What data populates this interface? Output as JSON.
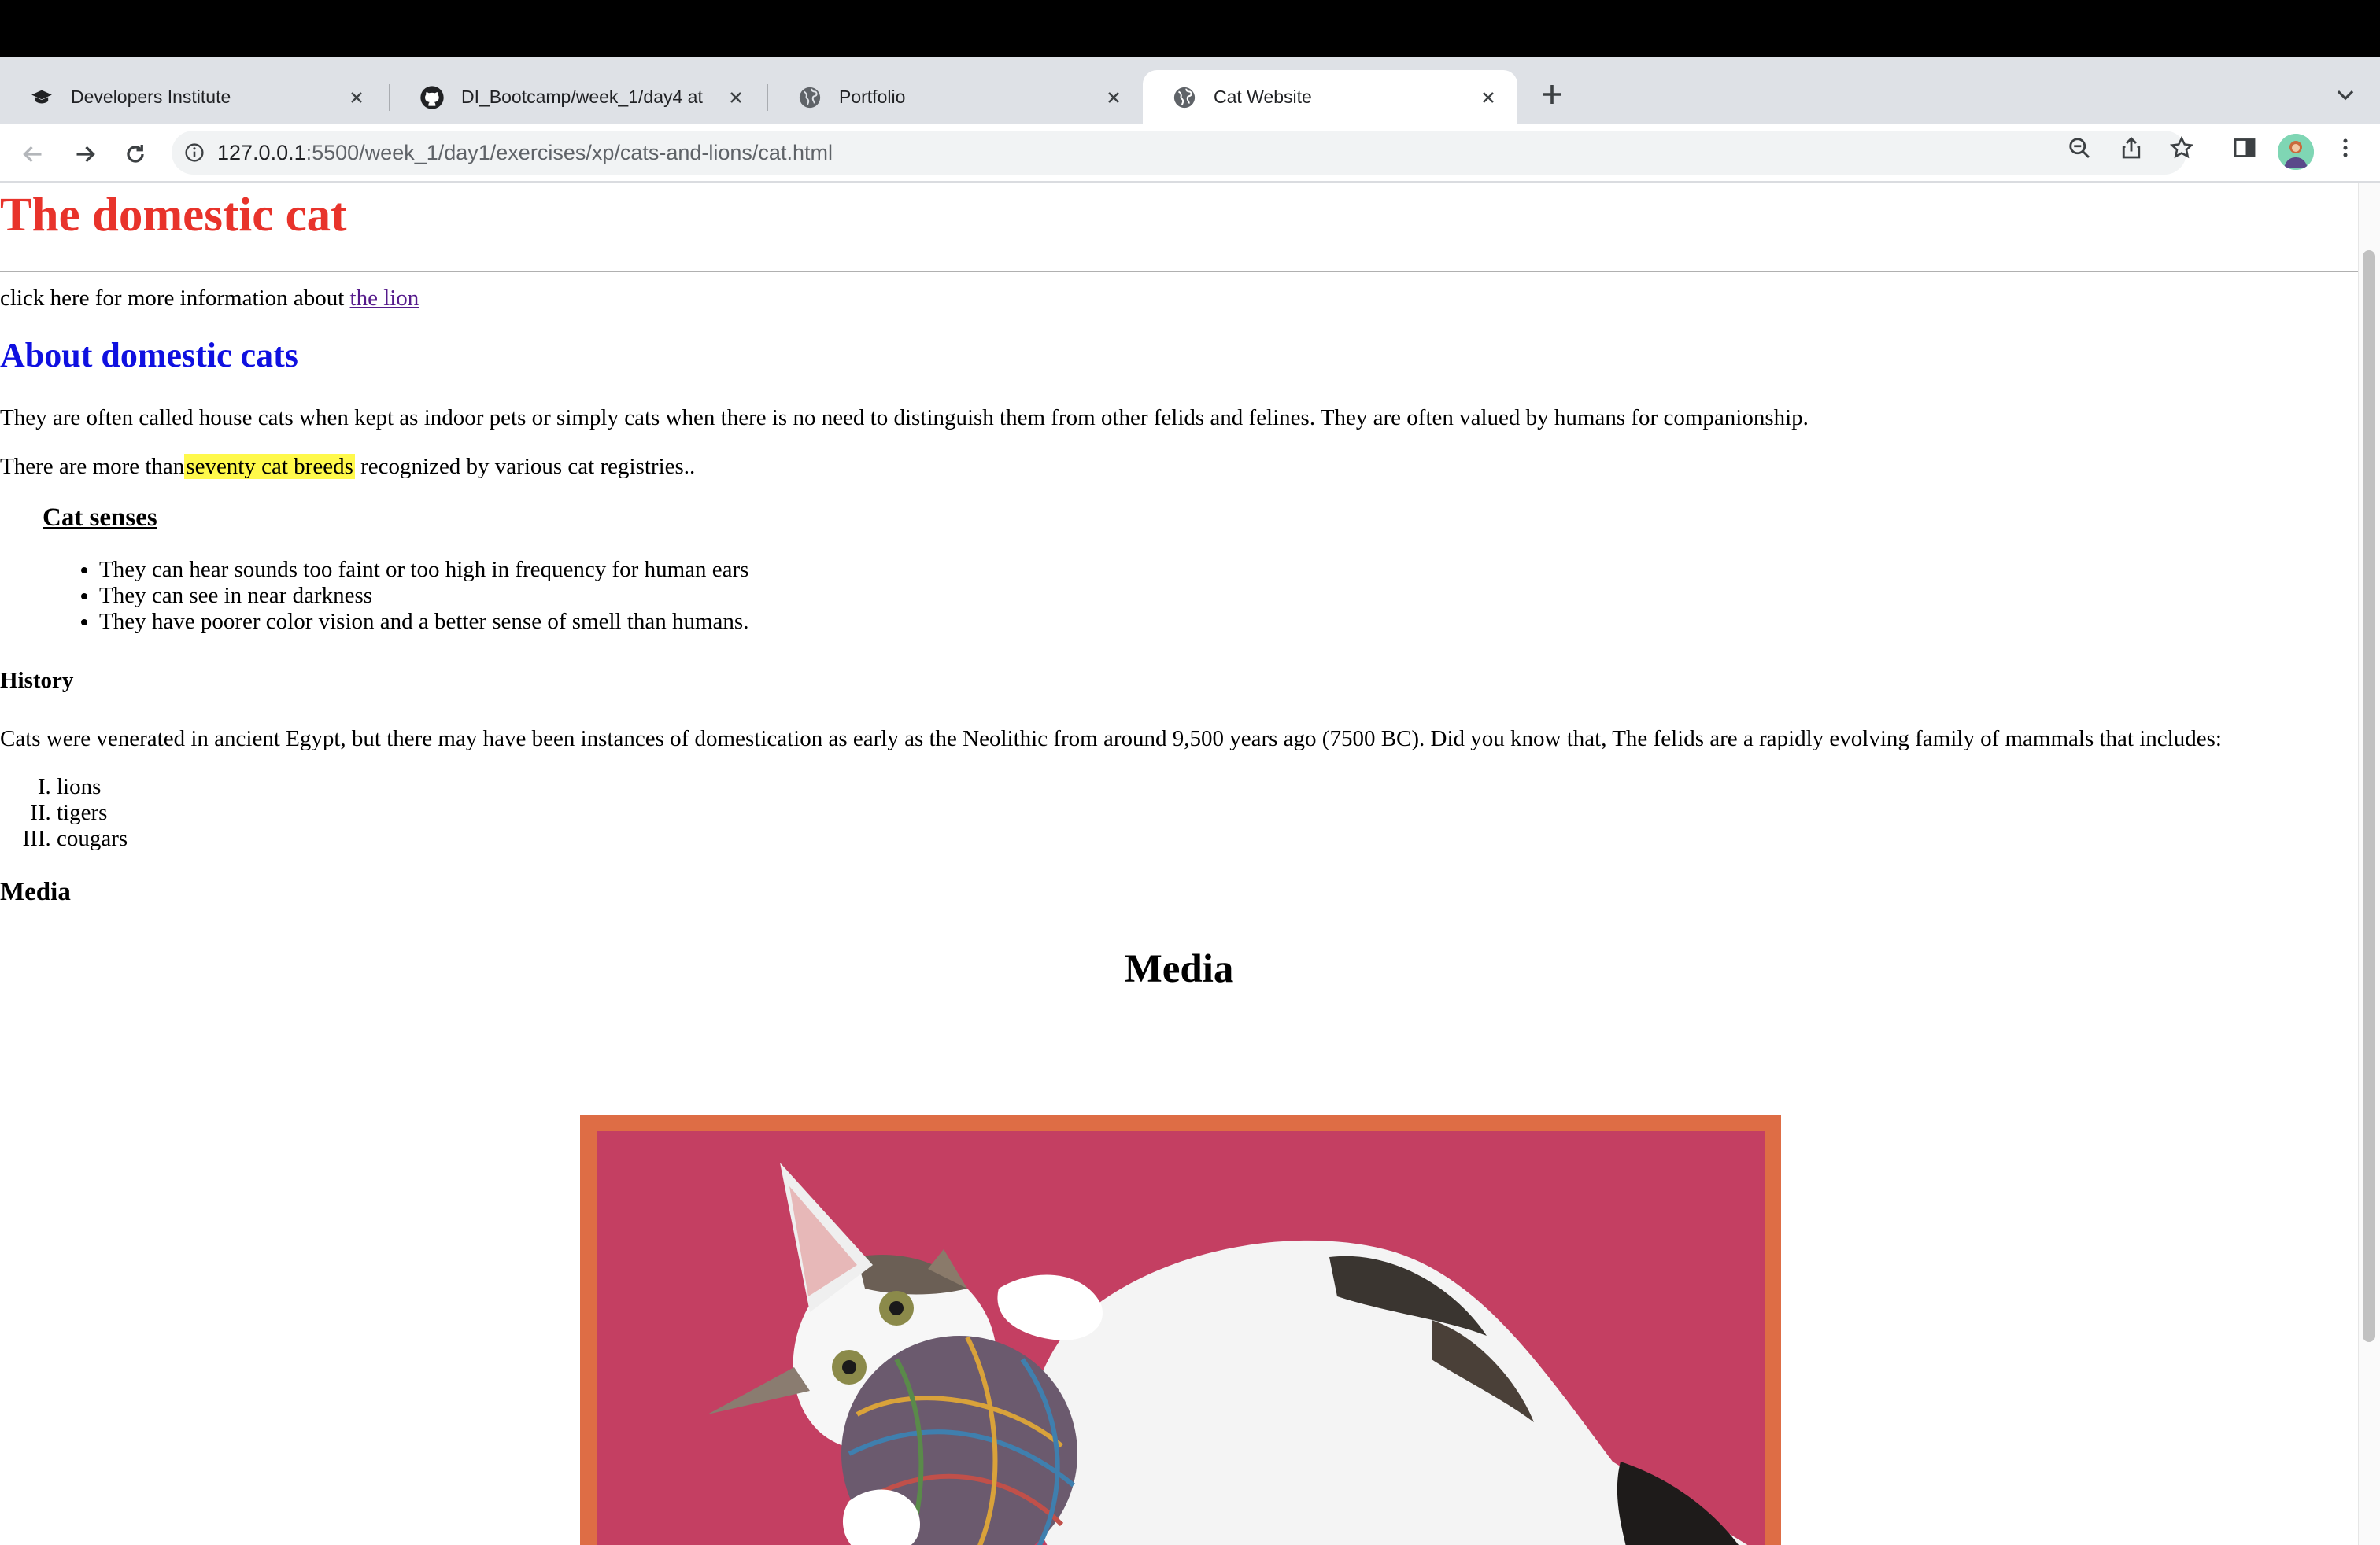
{
  "browser": {
    "tabs": [
      {
        "title": "Developers Institute",
        "icon": "graduation-cap-icon",
        "active": false
      },
      {
        "title": "DI_Bootcamp/week_1/day4 at",
        "icon": "github-icon",
        "active": false
      },
      {
        "title": "Portfolio",
        "icon": "globe-icon",
        "active": false
      },
      {
        "title": "Cat Website",
        "icon": "globe-icon",
        "active": true
      }
    ],
    "address": {
      "host": "127.0.0.1",
      "path": ":5500/week_1/day1/exercises/xp/cats-and-lions/cat.html"
    }
  },
  "page": {
    "title": "The domestic cat",
    "intro_text": "click here for more information about ",
    "lion_link": "the lion",
    "about_heading": "About domestic cats",
    "about_paragraph": "They are often called house cats when kept as indoor pets or simply cats when there is no need to distinguish them from other felids and felines. They are often valued by humans for companionship.",
    "breeds_before": "There are more than",
    "breeds_highlight": "seventy cat breeds",
    "breeds_after": " recognized by various cat registries..",
    "senses_heading": "Cat senses",
    "senses": [
      "They can hear sounds too faint or too high in frequency for human ears",
      "They can see in near darkness",
      "They have poorer color vision and a better sense of smell than humans."
    ],
    "history_heading": "History",
    "history_paragraph": "Cats were venerated in ancient Egypt, but there may have been instances of domestication as early as the Neolithic from around 9,500 years ago (7500 BC). Did you know that, The felids are a rapidly evolving family of mammals that includes:",
    "felids": [
      "lions",
      "tigers",
      "cougars"
    ],
    "media_heading": "Media",
    "media_title": "Media"
  },
  "colors": {
    "title": "#e8332b",
    "about_heading": "#0f10e0",
    "highlight": "#fff94b",
    "frame": "#de6d45",
    "photo_background": "#c43f62"
  }
}
